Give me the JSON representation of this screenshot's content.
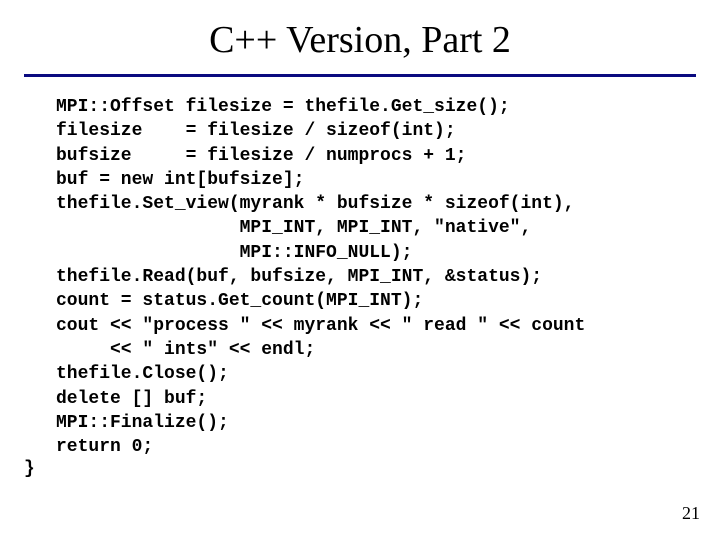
{
  "slide": {
    "title": "C++ Version, Part 2",
    "code": "MPI::Offset filesize = thefile.Get_size();\nfilesize    = filesize / sizeof(int);\nbufsize     = filesize / numprocs + 1;\nbuf = new int[bufsize];\nthefile.Set_view(myrank * bufsize * sizeof(int),\n                 MPI_INT, MPI_INT, \"native\",\n                 MPI::INFO_NULL);\nthefile.Read(buf, bufsize, MPI_INT, &status);\ncount = status.Get_count(MPI_INT);\ncout << \"process \" << myrank << \" read \" << count\n     << \" ints\" << endl;\nthefile.Close();\ndelete [] buf;\nMPI::Finalize();\nreturn 0;",
    "closebrace": "}",
    "page_number": "21"
  }
}
